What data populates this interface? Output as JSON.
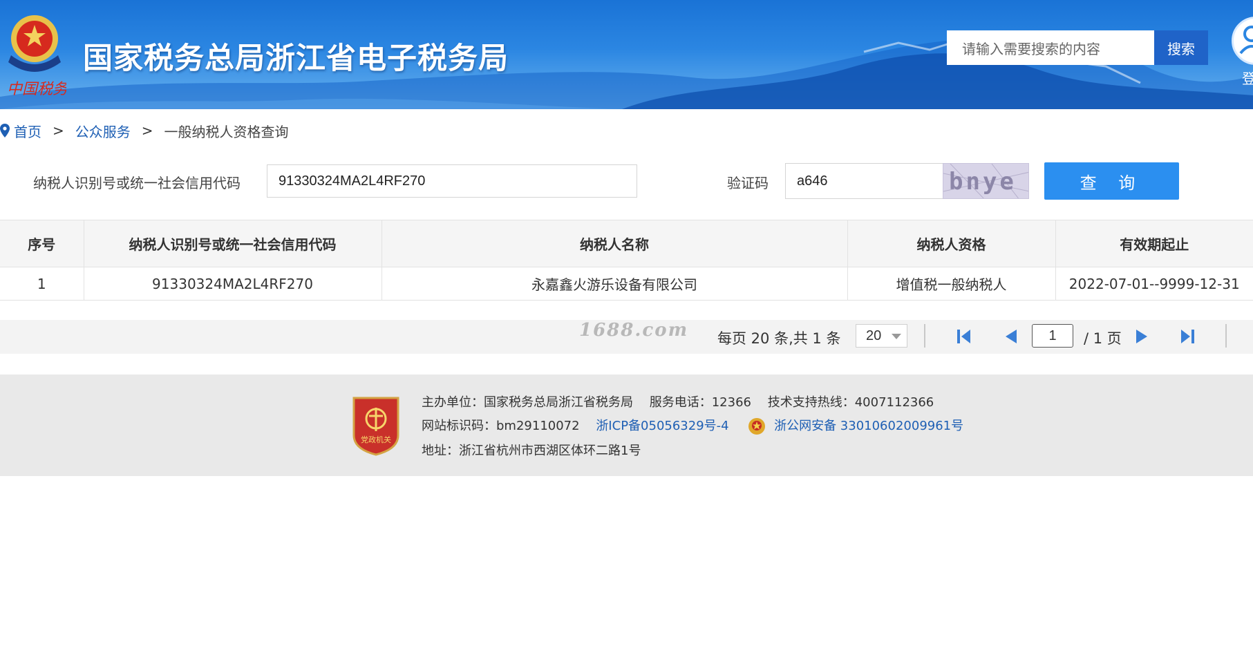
{
  "header": {
    "title": "国家税务总局浙江省电子税务局",
    "search_placeholder": "请输入需要搜索的内容",
    "search_button": "搜索",
    "login_label": "登"
  },
  "breadcrumb": {
    "items": [
      "首页",
      "公众服务",
      "一般纳税人资格查询"
    ],
    "separator": ">"
  },
  "form": {
    "taxpayer_id_label": "纳税人识别号或统一社会信用代码",
    "taxpayer_id_value": "91330324MA2L4RF270",
    "captcha_label": "验证码",
    "captcha_value": "a646",
    "captcha_image_text": "bnye",
    "query_button": "查 询"
  },
  "table": {
    "headers": [
      "序号",
      "纳税人识别号或统一社会信用代码",
      "纳税人名称",
      "纳税人资格",
      "有效期起止"
    ],
    "rows": [
      [
        "1",
        "91330324MA2L4RF270",
        "永嘉鑫火游乐设备有限公司",
        "增值税一般纳税人",
        "2022-07-01--9999-12-31"
      ]
    ]
  },
  "pager": {
    "watermark": "1688.com",
    "info": "每页 20 条,共 1 条",
    "page_size": "20",
    "current_page": "1",
    "total_pages": "/ 1 页"
  },
  "footer": {
    "organizer": "主办单位：国家税务总局浙江省税务局",
    "service_phone": "服务电话：12366",
    "support_hotline": "技术支持热线：4007112366",
    "site_id": "网站标识码：bm29110072",
    "icp": "浙ICP备05056329号-4",
    "police_record": "浙公网安备 33010602009961号",
    "address": "地址：浙江省杭州市西湖区体环二路1号",
    "badge_text": "党政机关"
  },
  "colors": {
    "brand_blue": "#1f63c8",
    "query_button": "#2b8ff0",
    "link": "#1e5fb4"
  }
}
